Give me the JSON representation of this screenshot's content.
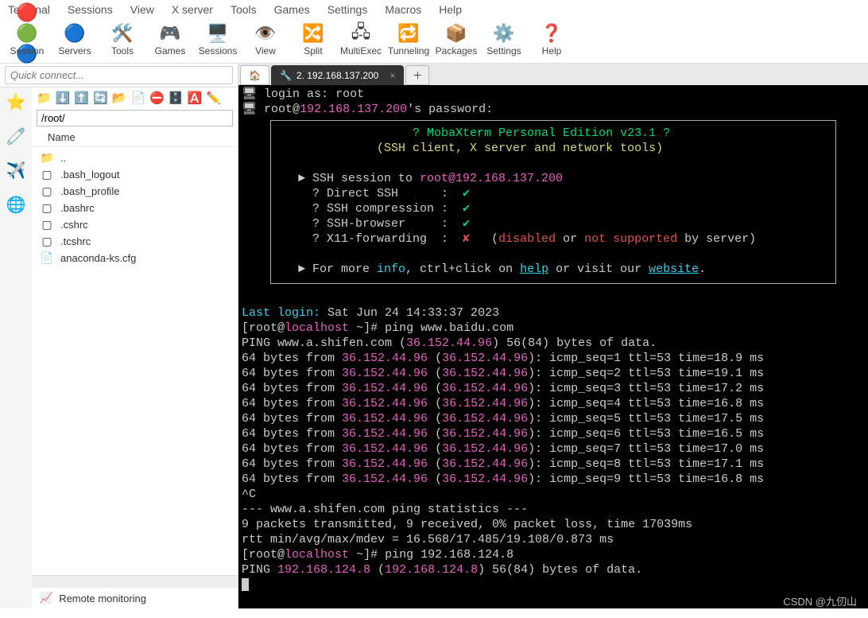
{
  "menu": [
    "Terminal",
    "Sessions",
    "View",
    "X server",
    "Tools",
    "Games",
    "Settings",
    "Macros",
    "Help"
  ],
  "tools": [
    {
      "icon": "🔴🟢🔵",
      "label": "Session"
    },
    {
      "icon": "🔵",
      "label": "Servers"
    },
    {
      "icon": "🛠️",
      "label": "Tools"
    },
    {
      "icon": "🎮",
      "label": "Games"
    },
    {
      "icon": "🖥️",
      "label": "Sessions"
    },
    {
      "icon": "👁️",
      "label": "View"
    },
    {
      "icon": "🔀",
      "label": "Split"
    },
    {
      "icon": "🖧",
      "label": "MultiExec"
    },
    {
      "icon": "🔁",
      "label": "Tunneling"
    },
    {
      "icon": "📦",
      "label": "Packages"
    },
    {
      "icon": "⚙️",
      "label": "Settings"
    },
    {
      "icon": "❓",
      "label": "Help"
    }
  ],
  "quick_placeholder": "Quick connect...",
  "vtabs": [
    "⭐",
    "🧷",
    "✈️",
    "🌐"
  ],
  "filetb": [
    "📁",
    "⬇️",
    "⬆️",
    "🔄",
    "📂",
    "📄",
    "⛔",
    "🗄️",
    "🅰️",
    "✏️"
  ],
  "path": "/root/",
  "col_name": "Name",
  "files": [
    {
      "icon": "📁",
      "name": "..",
      "cls": "dir"
    },
    {
      "icon": "▢",
      "name": ".bash_logout"
    },
    {
      "icon": "▢",
      "name": ".bash_profile"
    },
    {
      "icon": "▢",
      "name": ".bashrc"
    },
    {
      "icon": "▢",
      "name": ".cshrc"
    },
    {
      "icon": "▢",
      "name": ".tcshrc"
    },
    {
      "icon": "📄",
      "name": "anaconda-ks.cfg"
    }
  ],
  "remote_mon": "Remote monitoring",
  "tabs": {
    "home_icon": "🏠",
    "active_label": "2. 192.168.137.200",
    "active_icon": "🔧"
  },
  "term": {
    "login_as": "login as: ",
    "login_user": "root",
    "pw_line_prefix": "root@",
    "pw_host": "192.168.137.200",
    "pw_suffix": "'s password:",
    "banner_title": "? MobaXterm Personal Edition v23.1 ?",
    "banner_sub": "(SSH client, X server and network tools)",
    "ssh_to_prefix": "SSH session to ",
    "ssh_to_target": "root@192.168.137.200",
    "rows": [
      {
        "k": "Direct SSH",
        "ok": true
      },
      {
        "k": "SSH compression",
        "ok": true
      },
      {
        "k": "SSH-browser",
        "ok": true
      }
    ],
    "x11_label": "X11-forwarding",
    "x11_disabled": "disabled",
    "x11_or": " or ",
    "x11_not": "not supported",
    "x11_by": " by server)",
    "more_prefix": "For more ",
    "more_info": "info",
    "more_mid": ", ctrl+click on ",
    "more_help": "help",
    "more_mid2": " or visit our ",
    "more_site": "website",
    "last_login": "Last login:",
    "last_login_val": " Sat Jun 24 14:33:37 2023",
    "prompt_user": "root",
    "prompt_host": "localhost",
    "prompt_path": "~",
    "cmd1": "ping www.baidu.com",
    "ping_hdr_a": "PING www.a.shifen.com (",
    "ping_ip": "36.152.44.96",
    "ping_hdr_b": ") 56(84) bytes of data.",
    "pings": [
      {
        "seq": 1,
        "ttl": 53,
        "time": "18.9"
      },
      {
        "seq": 2,
        "ttl": 53,
        "time": "19.1"
      },
      {
        "seq": 3,
        "ttl": 53,
        "time": "17.2"
      },
      {
        "seq": 4,
        "ttl": 53,
        "time": "16.8"
      },
      {
        "seq": 5,
        "ttl": 53,
        "time": "17.5"
      },
      {
        "seq": 6,
        "ttl": 53,
        "time": "16.5"
      },
      {
        "seq": 7,
        "ttl": 53,
        "time": "17.0"
      },
      {
        "seq": 8,
        "ttl": 53,
        "time": "17.1"
      },
      {
        "seq": 9,
        "ttl": 53,
        "time": "16.8"
      }
    ],
    "ctrlc": "^C",
    "stats_hdr": "--- www.a.shifen.com ping statistics ---",
    "stats_line": "9 packets transmitted, 9 received, 0% packet loss, time 17039ms",
    "rtt": "rtt min/avg/max/mdev = 16.568/17.485/19.108/0.873 ms",
    "cmd2": "ping 192.168.124.8",
    "ping2_a": "PING ",
    "ping2_ip": "192.168.124.8",
    "ping2_b": " (",
    "ping2_c": ") 56(84) bytes of data."
  },
  "watermark": "CSDN @九仞山"
}
